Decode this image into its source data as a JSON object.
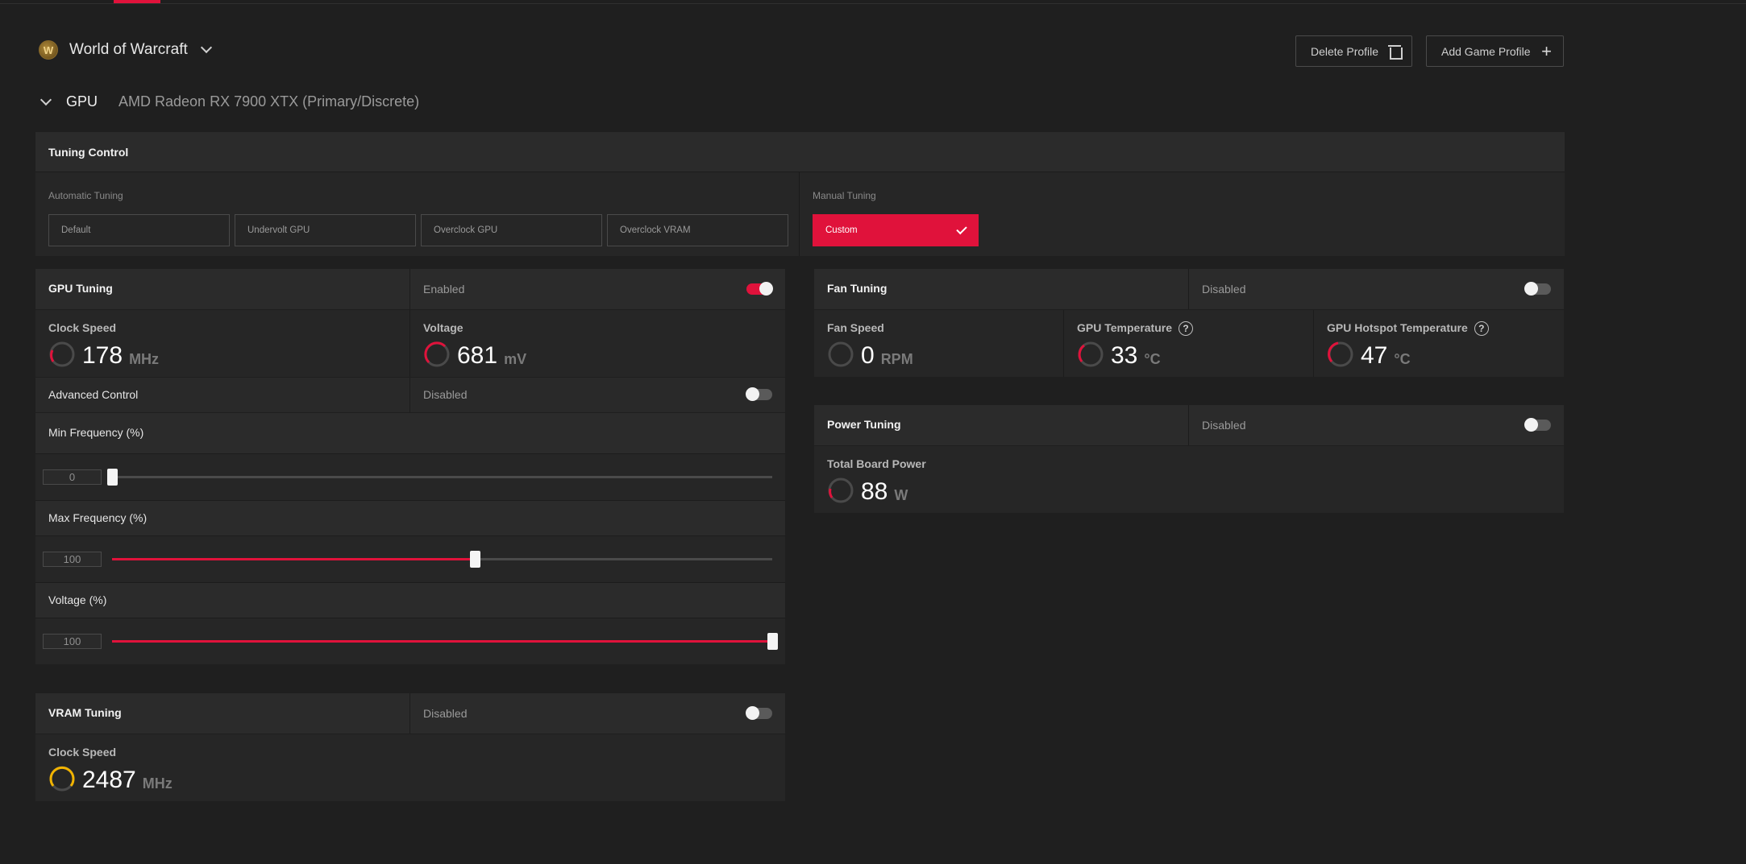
{
  "game": {
    "name": "World of Warcraft",
    "logo_letter": "W"
  },
  "profile_actions": {
    "delete_label": "Delete Profile",
    "add_label": "Add Game Profile"
  },
  "gpu": {
    "label": "GPU",
    "name": "AMD Radeon RX 7900 XTX (Primary/Discrete)"
  },
  "tuning_control": {
    "title": "Tuning Control",
    "automatic_label": "Automatic Tuning",
    "presets": [
      "Default",
      "Undervolt GPU",
      "Overclock GPU",
      "Overclock VRAM"
    ],
    "manual_label": "Manual Tuning",
    "manual_selected": "Custom"
  },
  "gpu_tuning": {
    "title": "GPU Tuning",
    "status": "Enabled",
    "enabled": true,
    "clock": {
      "label": "Clock Speed",
      "value": "178",
      "unit": "MHz"
    },
    "voltage": {
      "label": "Voltage",
      "value": "681",
      "unit": "mV"
    },
    "advanced": {
      "label": "Advanced Control",
      "status": "Disabled",
      "enabled": false
    },
    "min_freq": {
      "label": "Min Frequency (%)",
      "value": "0",
      "fraction": 0.0
    },
    "max_freq": {
      "label": "Max Frequency (%)",
      "value": "100",
      "fraction": 0.55
    },
    "voltage_pct": {
      "label": "Voltage (%)",
      "value": "100",
      "fraction": 1.0
    }
  },
  "vram_tuning": {
    "title": "VRAM Tuning",
    "status": "Disabled",
    "enabled": false,
    "clock": {
      "label": "Clock Speed",
      "value": "2487",
      "unit": "MHz"
    }
  },
  "fan_tuning": {
    "title": "Fan Tuning",
    "status": "Disabled",
    "enabled": false,
    "fan_speed": {
      "label": "Fan Speed",
      "value": "0",
      "unit": "RPM"
    },
    "gpu_temp": {
      "label": "GPU Temperature",
      "value": "33",
      "unit": "°C"
    },
    "hotspot_temp": {
      "label": "GPU Hotspot Temperature",
      "value": "47",
      "unit": "°C"
    },
    "help_glyph": "?"
  },
  "power_tuning": {
    "title": "Power Tuning",
    "status": "Disabled",
    "enabled": false,
    "board_power": {
      "label": "Total Board Power",
      "value": "88",
      "unit": "W"
    }
  },
  "colors": {
    "accent": "#e0123b",
    "vram_gauge": "#f1b300",
    "background": "#1f1f1f",
    "panel": "#262626"
  }
}
